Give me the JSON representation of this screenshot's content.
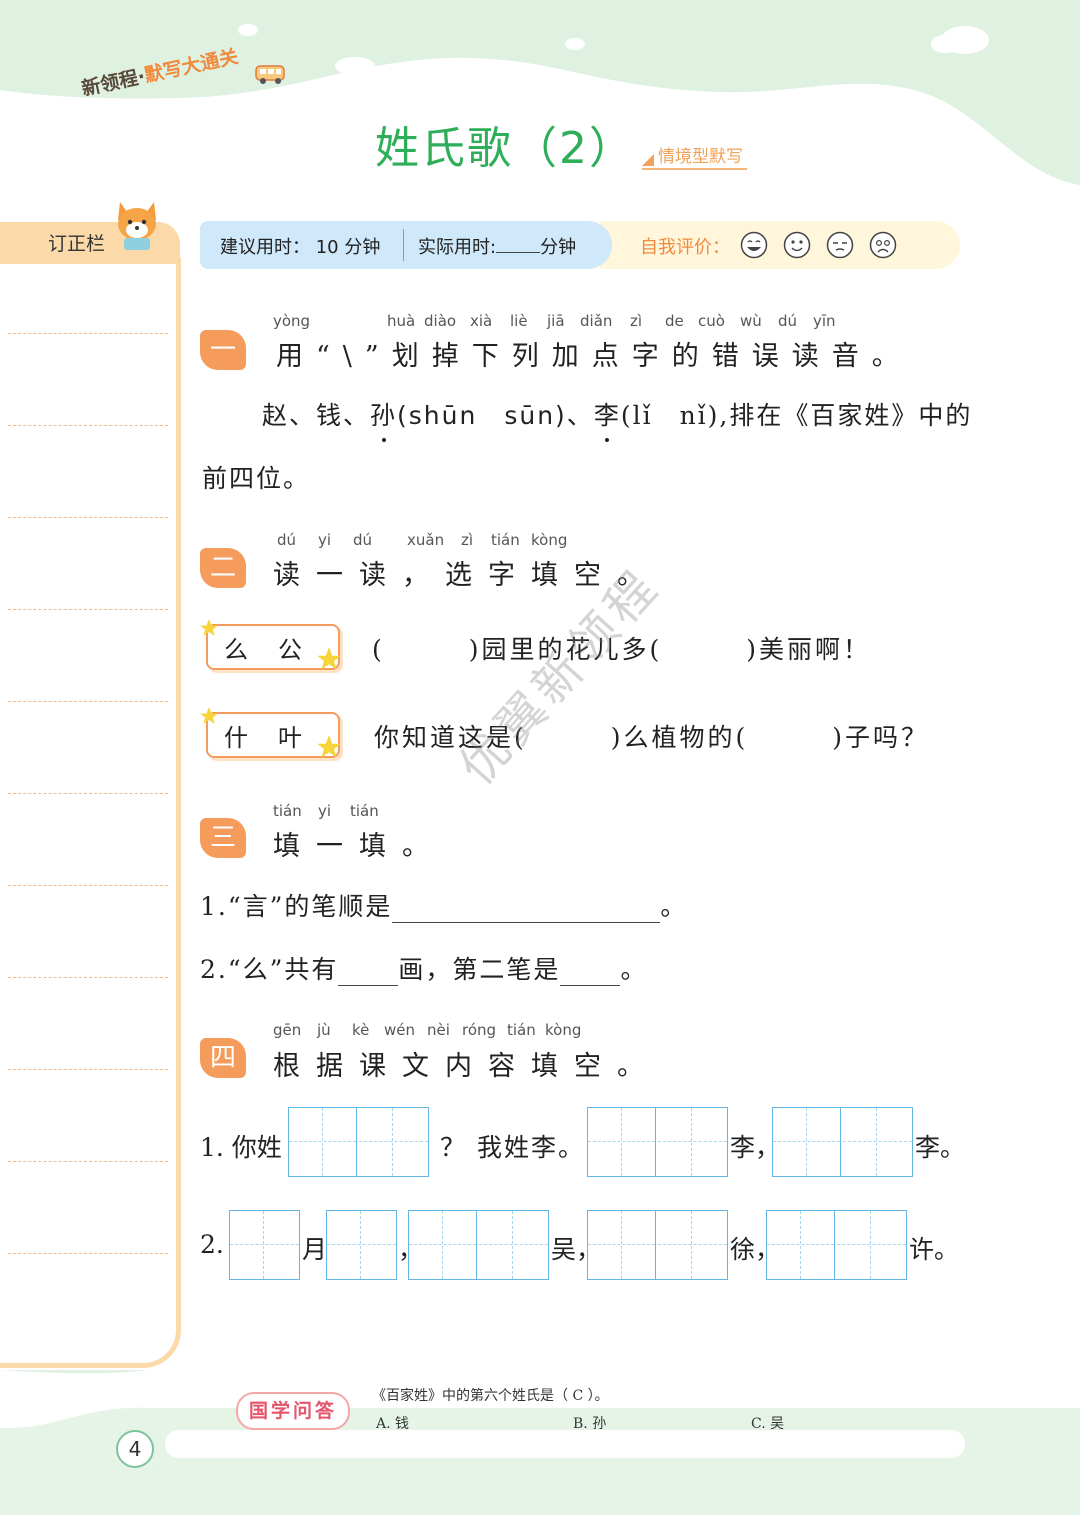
{
  "header": {
    "brand_a": "新领程",
    "brand_dot": "·",
    "brand_b": "默写大通关",
    "title": "姓氏歌（2）",
    "tag": "情境型默写"
  },
  "sidebar": {
    "label": "订正栏"
  },
  "timebar": {
    "suggest_label": "建议用时：",
    "suggest_value": "10 分钟",
    "actual_label": "实际用时:",
    "actual_unit": "分钟",
    "self_eval": "自我评价："
  },
  "s1": {
    "badge": "一",
    "pinyin": [
      "yòng",
      "huà",
      "diào",
      "xià",
      "liè",
      "jiā",
      "diǎn",
      "zì",
      "de",
      "cuò",
      "wù",
      "dú",
      "yīn"
    ],
    "head": "用“\\”划掉下列加点字的错误读音。",
    "line1_a": "赵、钱、",
    "line1_b": "孙",
    "line1_c": "(shūn　sūn)、",
    "line1_d": "李",
    "line1_e": "(lǐ　nǐ),排在《百家姓》中的",
    "line2": "前四位。"
  },
  "s2": {
    "badge": "二",
    "pinyin": [
      "dú",
      "yi",
      "dú",
      "xuǎn",
      "zì",
      "tián",
      "kòng"
    ],
    "head": "读一读，选字填空。",
    "card1": "么公",
    "line1": "(　　　)园里的花儿多(　　　)美丽啊！",
    "card2": "什叶",
    "line2": "你知道这是(　　　)么植物的(　　　)子吗？"
  },
  "s3": {
    "badge": "三",
    "pinyin": [
      "tián",
      "yi",
      "tián"
    ],
    "head": "填一填。",
    "q1": "1.“言”的笔顺是",
    "q1_end": "。",
    "q2_a": "2.“么”共有",
    "q2_b": "画，第二笔是",
    "q2_end": "。"
  },
  "s4": {
    "badge": "四",
    "pinyin": [
      "gēn",
      "jù",
      "kè",
      "wén",
      "nèi",
      "róng",
      "tián",
      "kòng"
    ],
    "head": "根据课文内容填空。",
    "r1_a": "1. 你姓",
    "r1_b": "？ 我姓李。",
    "r1_c": "李，",
    "r1_d": "李。",
    "r2_a": "2.",
    "r2_b": "月",
    "r2_c": "，",
    "r2_d": "吴，",
    "r2_e": "徐，",
    "r2_f": "许。"
  },
  "watermark": "优翼新领程",
  "footer": {
    "badge": "国学问答",
    "question": "《百家姓》中的第六个姓氏是（ C ）。",
    "options": [
      "A. 钱",
      "B. 孙",
      "C. 吴"
    ],
    "page": "4"
  },
  "colors": {
    "green": "#2fae5a",
    "orange": "#f59b5c",
    "blue_grid": "#63b5e6",
    "header_bg": "#dff2e2"
  }
}
